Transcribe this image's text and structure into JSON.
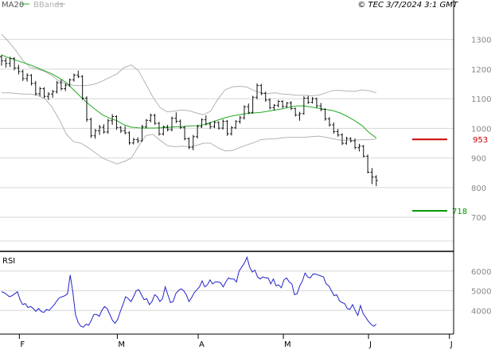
{
  "header": {
    "ma_label": "MA20",
    "bbands_label": "BBands",
    "copyright": "© TEC 3/7/2024 3:1 GMT"
  },
  "colors": {
    "ma": "#22aa22",
    "bbands": "#b4b4b4",
    "price": "#111111",
    "rsi": "#2222cc",
    "resistance": "#cc0000",
    "support": "#009900",
    "grid": "#d8d8d8",
    "frame": "#000000"
  },
  "chart_data": [
    {
      "type": "ohlc",
      "panel": "price",
      "ylim": [
        585,
        1385
      ],
      "y_ticks": [
        700,
        800,
        900,
        1000,
        1100,
        1200,
        1300
      ],
      "y_tick_labels": [
        "700",
        "800",
        "900",
        "1000",
        "1100",
        "1200",
        "1300"
      ],
      "x_labels": [
        "F",
        "M",
        "A",
        "M",
        "J",
        "J"
      ],
      "x_label_bar_index": [
        1,
        24,
        43,
        63,
        83,
        102
      ],
      "bars": [
        [
          1242,
          1248,
          1212,
          1228
        ],
        [
          1228,
          1238,
          1205,
          1219
        ],
        [
          1219,
          1242,
          1207,
          1236
        ],
        [
          1236,
          1240,
          1196,
          1204
        ],
        [
          1204,
          1215,
          1182,
          1192
        ],
        [
          1192,
          1198,
          1160,
          1168
        ],
        [
          1168,
          1186,
          1158,
          1179
        ],
        [
          1179,
          1183,
          1145,
          1152
        ],
        [
          1152,
          1160,
          1111,
          1117
        ],
        [
          1117,
          1140,
          1108,
          1134
        ],
        [
          1134,
          1139,
          1102,
          1108
        ],
        [
          1108,
          1122,
          1096,
          1116
        ],
        [
          1116,
          1130,
          1104,
          1124
        ],
        [
          1124,
          1160,
          1118,
          1154
        ],
        [
          1154,
          1165,
          1128,
          1134
        ],
        [
          1134,
          1152,
          1126,
          1146
        ],
        [
          1146,
          1168,
          1141,
          1164
        ],
        [
          1164,
          1185,
          1158,
          1180
        ],
        [
          1180,
          1195,
          1170,
          1175
        ],
        [
          1175,
          1180,
          1096,
          1102
        ],
        [
          1102,
          1108,
          1022,
          1030
        ],
        [
          1030,
          1036,
          968,
          975
        ],
        [
          975,
          998,
          965,
          992
        ],
        [
          992,
          1012,
          978,
          1004
        ],
        [
          1004,
          1014,
          982,
          988
        ],
        [
          988,
          1032,
          982,
          1026
        ],
        [
          1026,
          1048,
          1012,
          1040
        ],
        [
          1040,
          1044,
          995,
          1003
        ],
        [
          1003,
          1008,
          985,
          992
        ],
        [
          992,
          1008,
          980,
          985
        ],
        [
          985,
          990,
          945,
          951
        ],
        [
          951,
          968,
          946,
          962
        ],
        [
          962,
          970,
          950,
          958
        ],
        [
          958,
          1012,
          955,
          1006
        ],
        [
          1006,
          1032,
          1000,
          1027
        ],
        [
          1027,
          1050,
          1020,
          1044
        ],
        [
          1044,
          1049,
          1012,
          1017
        ],
        [
          1017,
          1022,
          976,
          981
        ],
        [
          981,
          1010,
          976,
          1005
        ],
        [
          1005,
          1012,
          990,
          996
        ],
        [
          996,
          1040,
          990,
          1034
        ],
        [
          1034,
          1054,
          1018,
          1024
        ],
        [
          1024,
          1030,
          998,
          1003
        ],
        [
          1003,
          1008,
          960,
          965
        ],
        [
          965,
          970,
          930,
          936
        ],
        [
          936,
          978,
          926,
          972
        ],
        [
          972,
          1012,
          966,
          1006
        ],
        [
          1006,
          1034,
          1001,
          1029
        ],
        [
          1029,
          1044,
          1010,
          1015
        ],
        [
          1015,
          1022,
          998,
          1006
        ],
        [
          1006,
          1026,
          1001,
          1020
        ],
        [
          1020,
          1024,
          996,
          1001
        ],
        [
          1001,
          1030,
          996,
          1024
        ],
        [
          1024,
          1028,
          975,
          982
        ],
        [
          982,
          1008,
          976,
          1002
        ],
        [
          1002,
          1028,
          998,
          1023
        ],
        [
          1023,
          1042,
          1016,
          1036
        ],
        [
          1036,
          1078,
          1030,
          1073
        ],
        [
          1073,
          1084,
          1048,
          1054
        ],
        [
          1054,
          1110,
          1050,
          1105
        ],
        [
          1105,
          1152,
          1098,
          1145
        ],
        [
          1145,
          1150,
          1112,
          1118
        ],
        [
          1118,
          1124,
          1090,
          1096
        ],
        [
          1096,
          1102,
          1064,
          1070
        ],
        [
          1070,
          1082,
          1060,
          1078
        ],
        [
          1078,
          1096,
          1071,
          1091
        ],
        [
          1091,
          1095,
          1068,
          1074
        ],
        [
          1074,
          1089,
          1070,
          1086
        ],
        [
          1086,
          1092,
          1062,
          1067
        ],
        [
          1067,
          1070,
          1040,
          1045
        ],
        [
          1045,
          1056,
          1026,
          1050
        ],
        [
          1050,
          1108,
          1046,
          1102
        ],
        [
          1102,
          1110,
          1082,
          1088
        ],
        [
          1088,
          1106,
          1084,
          1100
        ],
        [
          1100,
          1104,
          1070,
          1076
        ],
        [
          1076,
          1086,
          1058,
          1064
        ],
        [
          1064,
          1068,
          1026,
          1032
        ],
        [
          1032,
          1038,
          1006,
          1012
        ],
        [
          1012,
          1020,
          982,
          989
        ],
        [
          989,
          998,
          972,
          978
        ],
        [
          978,
          984,
          944,
          950
        ],
        [
          950,
          972,
          945,
          966
        ],
        [
          966,
          970,
          952,
          958
        ],
        [
          958,
          966,
          930,
          935
        ],
        [
          935,
          948,
          922,
          940
        ],
        [
          940,
          944,
          902,
          906
        ],
        [
          906,
          912,
          848,
          852
        ],
        [
          852,
          866,
          812,
          836
        ],
        [
          836,
          842,
          805,
          824
        ]
      ],
      "indicators": {
        "ma20": [
          1248,
          1238,
          1230,
          1222,
          1214,
          1204,
          1194,
          1184,
          1170,
          1154,
          1130,
          1106,
          1084,
          1064,
          1046,
          1034,
          1026,
          1012,
          1004,
          1002,
          1001,
          1001,
          1002,
          1003,
          1005,
          1006,
          1008,
          1009,
          1012,
          1020,
          1028,
          1036,
          1042,
          1046,
          1050,
          1052,
          1054,
          1058,
          1062,
          1066,
          1072,
          1076,
          1076,
          1072,
          1068,
          1064,
          1060,
          1052,
          1040,
          1026,
          1010,
          986,
          968
        ],
        "bb_upper": [
          1318,
          1292,
          1262,
          1228,
          1206,
          1200,
          1192,
          1178,
          1160,
          1150,
          1145,
          1144,
          1145,
          1150,
          1160,
          1172,
          1184,
          1205,
          1214,
          1195,
          1150,
          1106,
          1070,
          1056,
          1058,
          1062,
          1060,
          1052,
          1046,
          1058,
          1098,
          1130,
          1140,
          1142,
          1140,
          1128,
          1120,
          1118,
          1120,
          1116,
          1114,
          1112,
          1112,
          1110,
          1112,
          1120,
          1128,
          1128,
          1126,
          1125,
          1130,
          1127,
          1120
        ],
        "bb_lower": [
          1120,
          1120,
          1118,
          1116,
          1116,
          1112,
          1100,
          1072,
          1030,
          980,
          955,
          950,
          935,
          918,
          900,
          890,
          880,
          888,
          900,
          940,
          975,
          980,
          960,
          942,
          938,
          940,
          938,
          942,
          950,
          950,
          935,
          924,
          925,
          935,
          944,
          952,
          962,
          964,
          965,
          968,
          970,
          970,
          970,
          972,
          974,
          970,
          965,
          960,
          960,
          960,
          962,
          962,
          964
        ]
      },
      "levels": [
        {
          "label": "953",
          "value": 963,
          "role": "resistance"
        },
        {
          "label": "718",
          "value": 722,
          "role": "support"
        }
      ]
    },
    {
      "type": "line",
      "panel": "rsi",
      "title": "RSI",
      "ylim": [
        2800,
        7000
      ],
      "y_ticks": [
        4000,
        5000,
        6000
      ],
      "y_tick_labels": [
        "4000",
        "5000",
        "6000"
      ],
      "series": [
        {
          "name": "RSI",
          "values": [
            4950,
            4900,
            4800,
            4700,
            4750,
            4850,
            4950,
            4550,
            4300,
            4350,
            4150,
            4200,
            4100,
            3950,
            4100,
            3950,
            3900,
            4050,
            4000,
            4150,
            4300,
            4500,
            4650,
            4700,
            4750,
            4850,
            5800,
            4950,
            3800,
            3400,
            3200,
            3150,
            3300,
            3250,
            3500,
            3800,
            3800,
            3700,
            4000,
            4200,
            4100,
            3800,
            3500,
            3350,
            3550,
            3950,
            4300,
            4700,
            4600,
            4450,
            4700,
            5000,
            5050,
            4800,
            4550,
            4600,
            4300,
            4450,
            4800,
            4700,
            4450,
            4600,
            5200,
            4800,
            4400,
            4450,
            4850,
            5000,
            5100,
            5000,
            4800,
            4450,
            4650,
            4900,
            5050,
            5200,
            5500,
            5200,
            5300,
            5550,
            5350,
            5450,
            5450,
            5400,
            5200,
            5450,
            5650,
            5600,
            5600,
            5450,
            6000,
            6200,
            6400,
            6700,
            6200,
            5950,
            6050,
            5700,
            5600,
            5700,
            5650,
            5650,
            5350,
            5600,
            5250,
            5300,
            5150,
            5550,
            5650,
            5450,
            5350,
            4800,
            4850,
            5250,
            5500,
            5900,
            5700,
            5650,
            5850,
            5850,
            5800,
            5750,
            5700,
            5350,
            5250,
            5000,
            4750,
            4800,
            4500,
            4400,
            4350,
            4100,
            4050,
            4300,
            4000,
            3750,
            4250,
            3850,
            3650,
            3450,
            3300,
            3200,
            3300
          ]
        }
      ]
    }
  ]
}
